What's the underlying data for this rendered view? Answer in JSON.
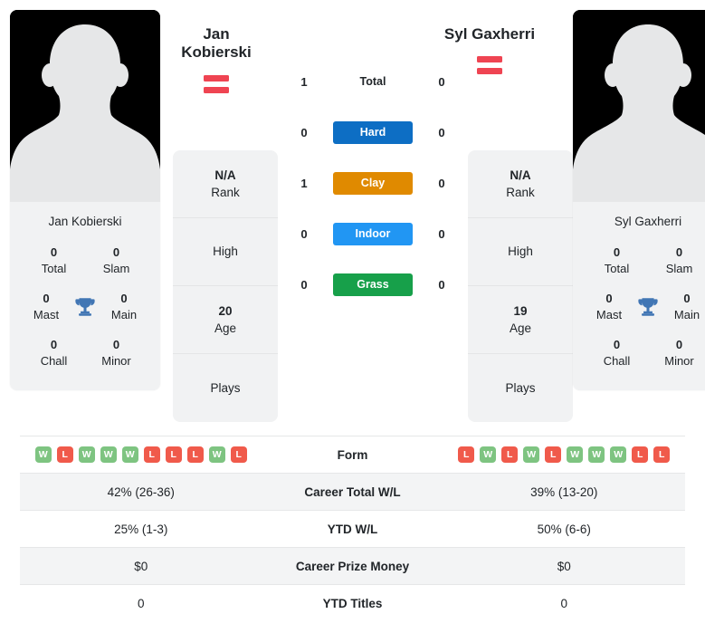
{
  "players": {
    "left": {
      "name": "Jan Kobierski",
      "display_name_lines": [
        "Jan",
        "Kobierski"
      ],
      "flag": "austria-flag",
      "card_name": "Jan Kobierski",
      "titles": {
        "total_value": "0",
        "total_label": "Total",
        "slam_value": "0",
        "slam_label": "Slam",
        "mast_value": "0",
        "mast_label": "Mast",
        "main_value": "0",
        "main_label": "Main",
        "chall_value": "0",
        "chall_label": "Chall",
        "minor_value": "0",
        "minor_label": "Minor"
      },
      "info": {
        "rank_value": "N/A",
        "rank_label": "Rank",
        "high_value": "",
        "high_label": "High",
        "age_value": "20",
        "age_label": "Age",
        "plays_value": "",
        "plays_label": "Plays"
      },
      "form": [
        "W",
        "L",
        "W",
        "W",
        "W",
        "L",
        "L",
        "L",
        "W",
        "L"
      ],
      "surface": {
        "total": "1",
        "hard": "0",
        "clay": "1",
        "indoor": "0",
        "grass": "0"
      },
      "stats": {
        "career_total_wl": "42% (26-36)",
        "ytd_wl": "25% (1-3)",
        "career_prize_money": "$0",
        "ytd_titles": "0"
      }
    },
    "right": {
      "name": "Syl Gaxherri",
      "display_name_lines": [
        "Syl Gaxherri"
      ],
      "flag": "austria-flag",
      "card_name": "Syl Gaxherri",
      "titles": {
        "total_value": "0",
        "total_label": "Total",
        "slam_value": "0",
        "slam_label": "Slam",
        "mast_value": "0",
        "mast_label": "Mast",
        "main_value": "0",
        "main_label": "Main",
        "chall_value": "0",
        "chall_label": "Chall",
        "minor_value": "0",
        "minor_label": "Minor"
      },
      "info": {
        "rank_value": "N/A",
        "rank_label": "Rank",
        "high_value": "",
        "high_label": "High",
        "age_value": "19",
        "age_label": "Age",
        "plays_value": "",
        "plays_label": "Plays"
      },
      "form": [
        "L",
        "W",
        "L",
        "W",
        "L",
        "W",
        "W",
        "W",
        "L",
        "L"
      ],
      "surface": {
        "total": "0",
        "hard": "0",
        "clay": "0",
        "indoor": "0",
        "grass": "0"
      },
      "stats": {
        "career_total_wl": "39% (13-20)",
        "ytd_wl": "50% (6-6)",
        "career_prize_money": "$0",
        "ytd_titles": "0"
      }
    }
  },
  "surfaces": {
    "total_label": "Total",
    "hard_label": "Hard",
    "clay_label": "Clay",
    "indoor_label": "Indoor",
    "grass_label": "Grass",
    "colors": {
      "hard": "#0d6ec4",
      "clay": "#e08a00",
      "indoor": "#2196f3",
      "grass": "#17a04a"
    }
  },
  "table": {
    "form_label": "Form",
    "career_total_wl_label": "Career Total W/L",
    "ytd_wl_label": "YTD W/L",
    "career_prize_money_label": "Career Prize Money",
    "ytd_titles_label": "YTD Titles"
  },
  "colors": {
    "win_badge": "#7ec481",
    "loss_badge": "#f05a4b",
    "card_background": "#f1f2f3",
    "flag_red": "#ef4452"
  }
}
